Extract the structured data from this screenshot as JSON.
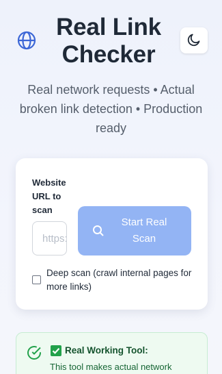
{
  "header": {
    "title": "Real Link Checker",
    "subtitle": "Real network requests • Actual broken link detection • Production ready"
  },
  "scan_form": {
    "url_label": "Website URL to scan",
    "url_placeholder": "https://example.com",
    "url_value": "",
    "scan_button_label": "Start Real Scan",
    "scan_button_icon": "search-icon",
    "deep_scan_checked": false,
    "deep_scan_label": "Deep scan (crawl internal pages for more links)"
  },
  "notice": {
    "title": "Real Working Tool:",
    "body": "This tool makes actual network"
  },
  "colors": {
    "accent": "#3b66d6",
    "button_disabled": "#93b4f4",
    "success": "#21a14a"
  }
}
